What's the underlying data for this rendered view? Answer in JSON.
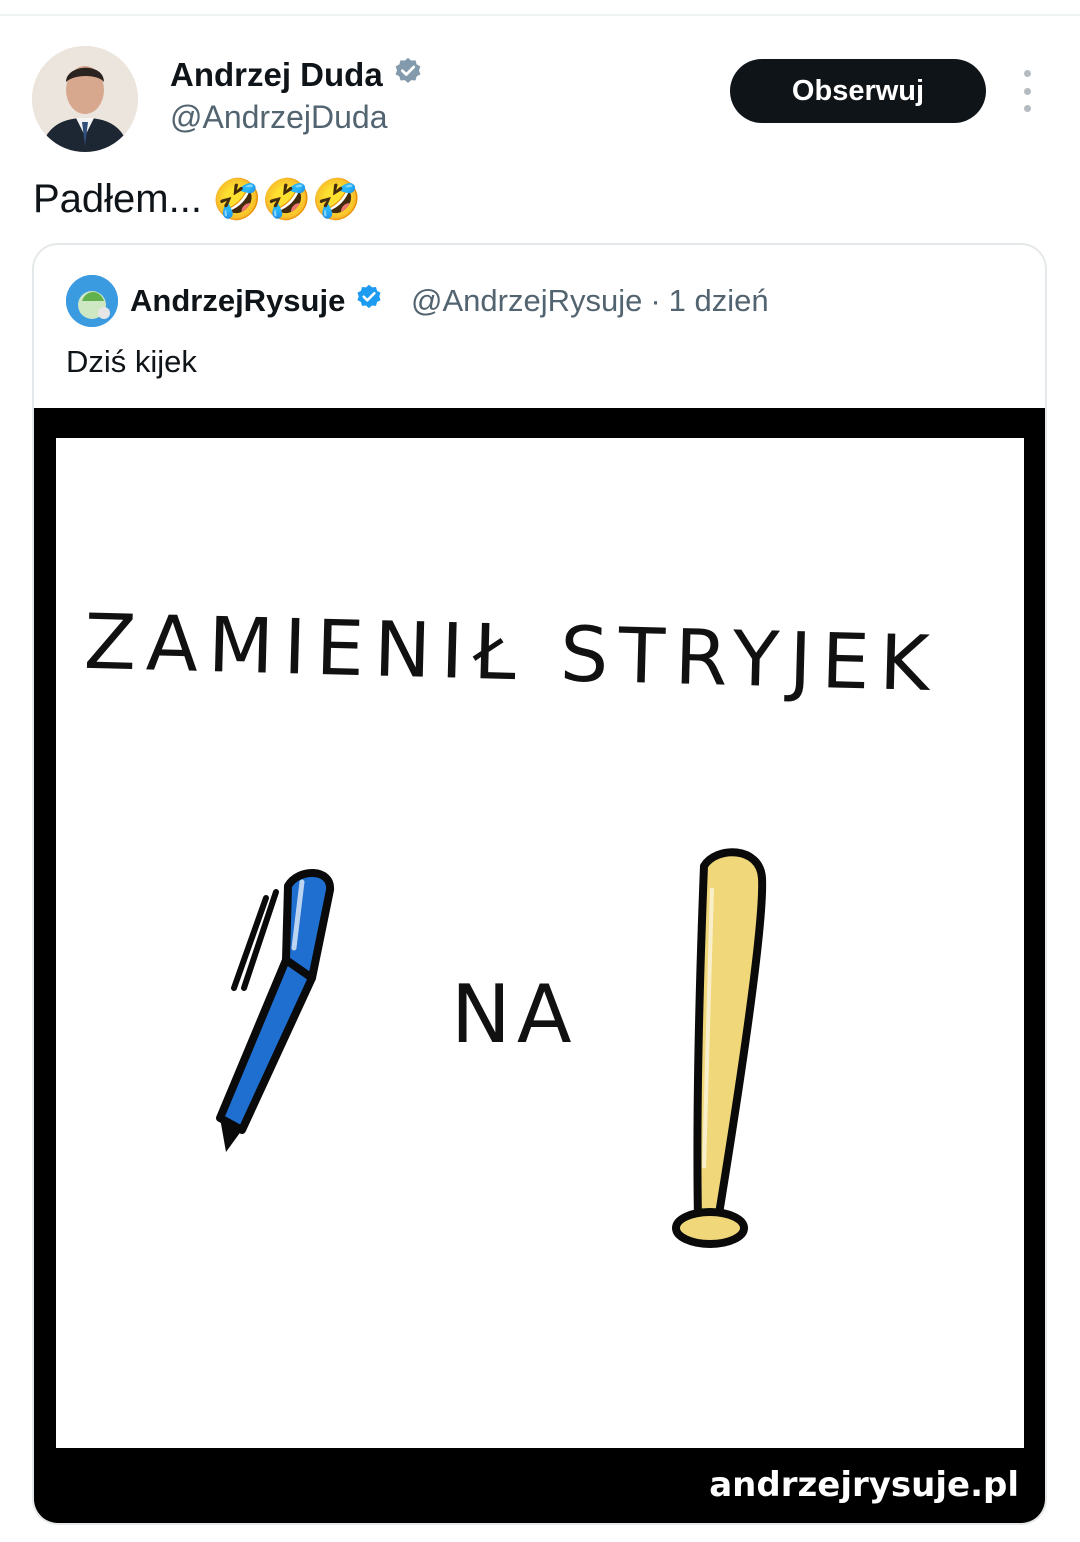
{
  "tweet": {
    "author": {
      "name": "Andrzej Duda",
      "handle": "@AndrzejDuda",
      "verified_color": "#829aab"
    },
    "follow_label": "Obserwuj",
    "text": "Padłem...",
    "emoji": [
      "🤣",
      "🤣",
      "🤣"
    ]
  },
  "quote": {
    "author_name": "AndrzejRysuje",
    "handle": "@AndrzejRysuje",
    "separator": "·",
    "time": "1 dzień",
    "text": "Dziś kijek",
    "verified_color": "#1d9bf0",
    "image": {
      "line1": "ZAMIENIŁ STRYJEK",
      "line2": "NA",
      "watermark": "andrzejrysuje.pl",
      "pen_color": "#1e6fd0",
      "bat_color": "#f0d77a"
    }
  }
}
